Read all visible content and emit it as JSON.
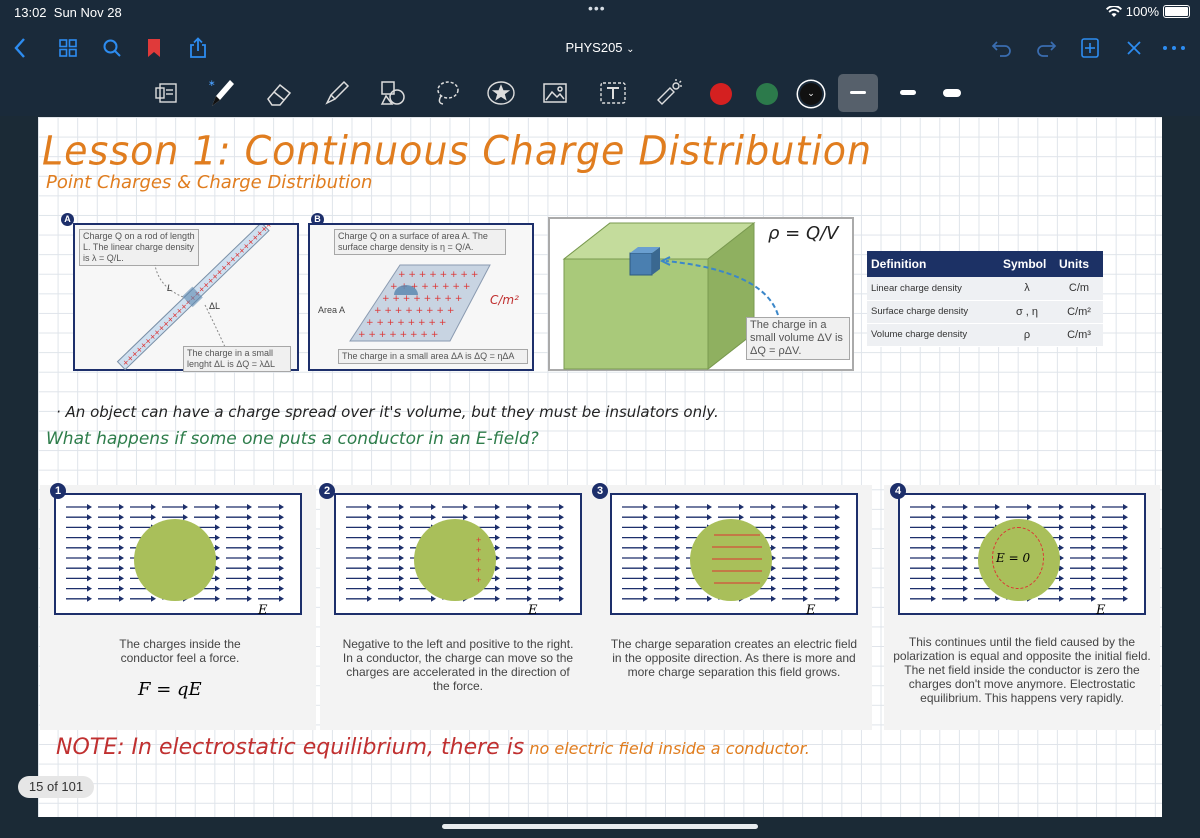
{
  "status": {
    "time": "13:02",
    "date": "Sun Nov 28",
    "battery": "100%"
  },
  "nav": {
    "title": "PHYS205"
  },
  "toolbar": {
    "colors": [
      "#d42020",
      "#2c7a4b",
      "#111111"
    ]
  },
  "page": {
    "title": "Lesson 1: Continuous Charge Distribution",
    "subtitle": "Point Charges & Charge Distribution",
    "figA": {
      "badge": "A",
      "caption": "Charge Q on a rod of length L. The linear charge density is λ = Q/L.",
      "caption2": "The charge in a small lenght ΔL is ΔQ = λΔL",
      "L": "L",
      "dL": "ΔL"
    },
    "figB": {
      "badge": "B",
      "caption": "Charge Q on a surface of area A. The surface charge density is η = Q/A.",
      "caption2": "The charge in a small area ΔA is ΔQ = ηΔA",
      "area": "Area A",
      "unit": "C/m²"
    },
    "figC": {
      "rho": "ρ = Q/V",
      "caption": "The charge in a small volume ΔV is ΔQ = ρΔV."
    },
    "table": {
      "headers": [
        "Definition",
        "Symbol",
        "Units"
      ],
      "rows": [
        [
          "Linear charge density",
          "λ",
          "C/m"
        ],
        [
          "Surface charge density",
          "σ , η",
          "C/m²"
        ],
        [
          "Volume charge density",
          "ρ",
          "C/m³"
        ]
      ]
    },
    "note1": "· An object can have a charge spread over it's volume, but they must be insulators only.",
    "note2": "What happens if some one puts a conductor in an E-field?",
    "panels": [
      {
        "num": "1",
        "text": "The charges inside the conductor feel a force.",
        "formula": "F = qE",
        "elabel": "E"
      },
      {
        "num": "2",
        "text": "Negative to the left and positive to the right. In a conductor, the charge can move so the charges are accelerated in the direction of the force.",
        "elabel": "E"
      },
      {
        "num": "3",
        "text": "The charge separation creates an electric field in the opposite direction. As there is more and more charge separation this field grows.",
        "elabel": "E"
      },
      {
        "num": "4",
        "text": "This continues until the field caused by the polarization is equal and opposite the initial field. The net field inside the conductor is zero the charges don't move anymore. Electrostatic equilibrium. This happens very rapidly.",
        "elabel": "E",
        "inner": "E = 0"
      }
    ],
    "note3a": "NOTE: In electrostatic equilibrium, there is",
    "note3b": "no electric field inside a conductor."
  },
  "page_indicator": "15 of 101"
}
